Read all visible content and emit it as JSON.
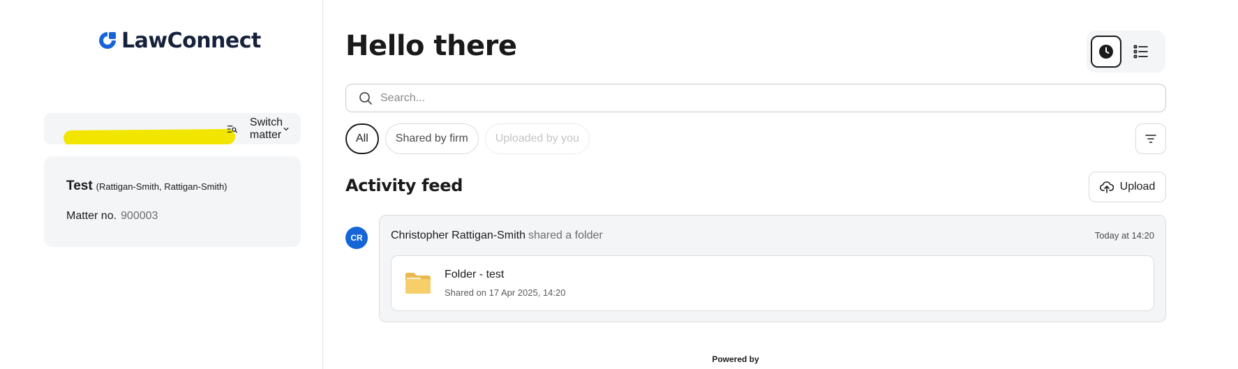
{
  "brand": {
    "name": "LawConnect"
  },
  "sidebar": {
    "switch_matter_label": "Switch matter",
    "matter": {
      "name": "Test",
      "parties": "(Rattigan-Smith, Rattigan-Smith)",
      "number_label": "Matter no.",
      "number_value": "900003"
    }
  },
  "main": {
    "greeting": "Hello there",
    "view_toggle": {
      "icons": [
        "clock-icon",
        "list-icon"
      ],
      "active": "clock-icon"
    },
    "search": {
      "placeholder": "Search..."
    },
    "filters": [
      {
        "label": "All",
        "state": "active"
      },
      {
        "label": "Shared by firm",
        "state": "default"
      },
      {
        "label": "Uploaded by you",
        "state": "disabled"
      }
    ],
    "feed_title": "Activity feed",
    "upload_label": "Upload",
    "activity": {
      "avatar_initials": "CR",
      "actor": "Christopher Rattigan-Smith",
      "action": "shared a folder",
      "time": "Today at 14:20",
      "folder": {
        "name": "Folder - test",
        "shared_on": "Shared on 17 Apr 2025, 14:20"
      }
    },
    "footer": {
      "powered_by": "Powered by"
    }
  },
  "colors": {
    "brand_blue": "#1565d8",
    "highlight_yellow": "#f2e600",
    "card_bg": "#f4f5f7",
    "folder_yellow": "#f6cf6a"
  }
}
